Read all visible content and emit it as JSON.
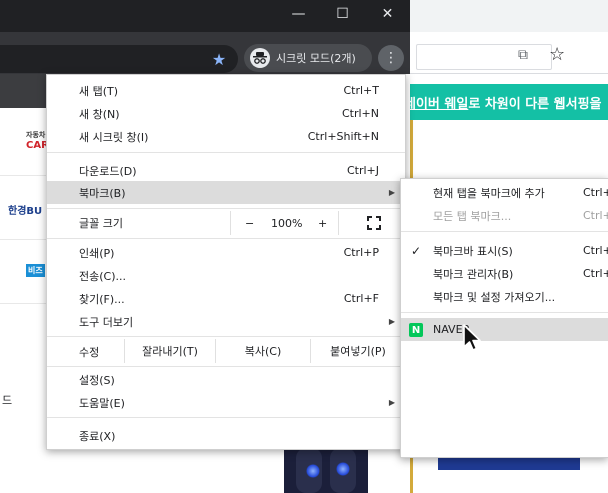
{
  "window": {
    "minimize_glyph": "—",
    "maximize_glyph": "☐",
    "close_glyph": "✕",
    "incognito_label": "시크릿 모드(2개)",
    "more_glyph": "⋮"
  },
  "page_behind": {
    "banner_link": "네이버 웨일",
    "banner_rest": "로 차원이 다른 웹서핑을",
    "brand_1_line1": "자동차",
    "brand_1_line2": "CAR",
    "brand_2": "한경BU",
    "brand_3": "비즈",
    "side_text": "드"
  },
  "menu": {
    "new_tab": {
      "label": "새 탭(T)",
      "shortcut": "Ctrl+T"
    },
    "new_window": {
      "label": "새 창(N)",
      "shortcut": "Ctrl+N"
    },
    "new_incognito": {
      "label": "새 시크릿 창(I)",
      "shortcut": "Ctrl+Shift+N"
    },
    "downloads": {
      "label": "다운로드(D)",
      "shortcut": "Ctrl+J"
    },
    "bookmarks": {
      "label": "북마크(B)"
    },
    "zoom": {
      "label": "글꼴 크기",
      "minus": "−",
      "value": "100%",
      "plus": "+"
    },
    "print": {
      "label": "인쇄(P)",
      "shortcut": "Ctrl+P"
    },
    "cast": {
      "label": "전송(C)..."
    },
    "find": {
      "label": "찾기(F)...",
      "shortcut": "Ctrl+F"
    },
    "more_tools": {
      "label": "도구 더보기"
    },
    "edit": {
      "label": "수정",
      "cut": "잘라내기(T)",
      "copy": "복사(C)",
      "paste": "붙여넣기(P)"
    },
    "settings": {
      "label": "설정(S)"
    },
    "help": {
      "label": "도움말(E)"
    },
    "exit": {
      "label": "종료(X)"
    }
  },
  "bookmarks_submenu": {
    "bookmark_tab": {
      "label": "현재 탭을 북마크에 추가",
      "shortcut": "Ctrl+D"
    },
    "bookmark_all": {
      "label": "모든 탭 북마크...",
      "shortcut": "Ctrl+Shift+D"
    },
    "show_bar": {
      "label": "북마크바 표시(S)",
      "shortcut": "Ctrl+Shift+B",
      "checked": true
    },
    "manager": {
      "label": "북마크 관리자(B)",
      "shortcut": "Ctrl+Shift+O"
    },
    "import": {
      "label": "북마크 및 설정 가져오기..."
    },
    "naver": {
      "label": "NAVER",
      "icon_letter": "N"
    }
  },
  "colors": {
    "incognito_bg": "#202124",
    "banner": "#14c0a5",
    "naver_green": "#03c75a",
    "highlight": "#dcdcdc"
  }
}
